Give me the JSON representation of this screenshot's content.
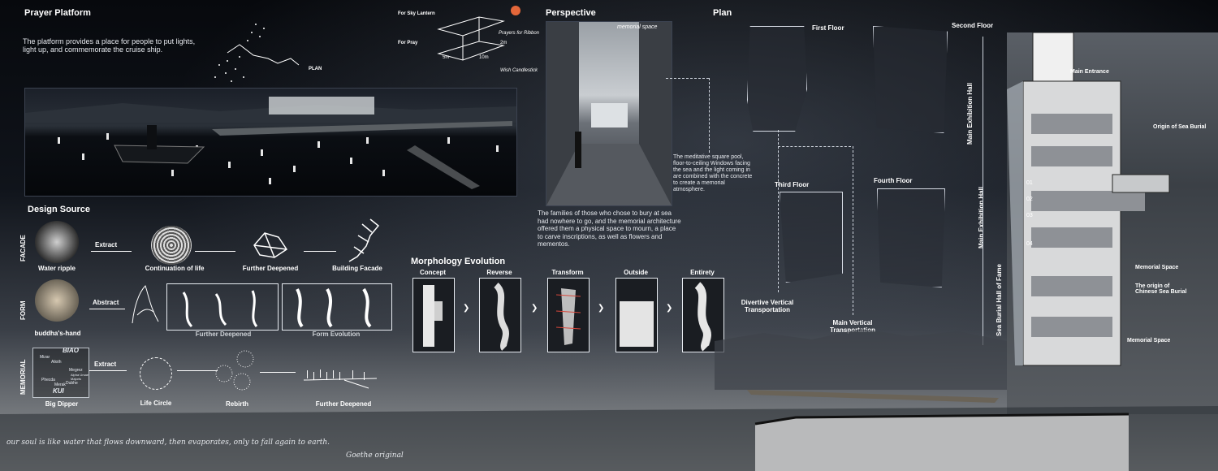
{
  "prayer_platform": {
    "title": "Prayer Platform",
    "desc": "The platform provides a place for people to put lights, light up, and commemorate the cruise ship.",
    "plan_label": "PLAN",
    "for_sky_lantern": "For Sky Lantern",
    "for_pray": "For Pray",
    "prayers_for_ribbon": "Prayers for Ribbon",
    "wish_candlestick": "Wish Candlestick",
    "dim_2m": "2m",
    "dim_5m": "5m",
    "dim_10m": "10m"
  },
  "perspective": {
    "title": "Perspective",
    "memorial_space": "memorial space",
    "desc1": "The meditative square pool, floor-to-ceiling Windows facing the sea and the light coming in are combined with the concrete to create a memorial atmosphere.",
    "desc2": "The families of those who chose to bury at sea had nowhere to go, and the memorial architecture offered them a physical space to mourn, a place to carve inscriptions, as well as flowers and mementos."
  },
  "plan": {
    "title": "Plan",
    "first_floor": "First Floor",
    "second_floor": "Second Floor",
    "third_floor": "Third Floor",
    "fourth_floor": "Fourth Floor",
    "divertive_vertical": "Divertive Vertical Transportation",
    "main_vertical": "Main Vertical Transportation"
  },
  "section": {
    "main_entrance": "Main Entrance",
    "main_exhibition_hall": "Main Exhibition Hall",
    "main_exhibition_hall_2": "Main Exhibition Hall",
    "sea_burial_hall": "Sea Burial Hall of Fame",
    "origin_sea_burial": "Origin of Sea Burial",
    "memorial_space_1": "Memorial Space",
    "origin_chinese": "The origin of Chinese Sea Burial",
    "memorial_space_2": "Memorial Space",
    "levels": [
      "01",
      "02",
      "03",
      "04"
    ]
  },
  "design_source": {
    "title": "Design Source",
    "row_facade": "FACADE",
    "row_form": "FORM",
    "row_memorial": "MEMORIAL",
    "water_ripple": "Water ripple",
    "extract1": "Extract",
    "continuation": "Continuation of life",
    "further_deepened1": "Further Deepened",
    "building_facade": "Building Facade",
    "buddhas_hand": "buddha's-hand",
    "abstract": "Abstract",
    "further_deepened2": "Further Deepened",
    "form_evolution": "Form Evolution",
    "biao": "BIAO",
    "kui": "KUI",
    "big_dipper": "Big Dipper",
    "extract2": "Extract",
    "life_circle": "Life Circle",
    "rebirth": "Rebirth",
    "further_deepened3": "Further Deepened",
    "stars": [
      "Alioth",
      "Mizar",
      "Megrez",
      "Phecda",
      "Merak",
      "Dubhe"
    ],
    "star_note": "Alpha Ursae Majoris"
  },
  "morphology": {
    "title": "Morphology Evolution",
    "steps": [
      "Concept",
      "Reverse",
      "Transform",
      "Outside",
      "Entirety"
    ]
  },
  "quote": {
    "text": "our soul is like water that flows downward, then evaporates, only to fall again to earth.",
    "author": "Goethe original"
  },
  "colors": {
    "bg": "#0c0f14",
    "accent": "#ffffff",
    "sea": "#6b6f74"
  }
}
